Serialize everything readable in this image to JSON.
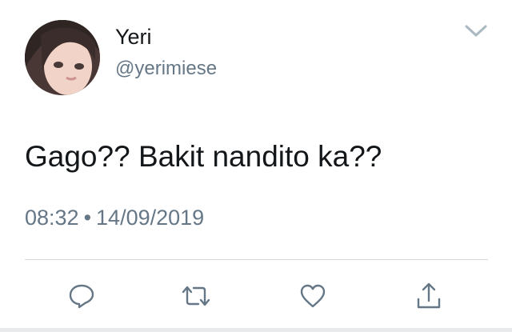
{
  "user": {
    "display_name": "Yeri",
    "handle": "@yerimiese"
  },
  "tweet": {
    "text": "Gago?? Bakit nandito ka??",
    "time": "08:32",
    "separator": "•",
    "date": "14/09/2019"
  },
  "icons": {
    "menu": "chevron-down-icon",
    "reply": "reply-icon",
    "retweet": "retweet-icon",
    "like": "heart-icon",
    "share": "share-icon"
  },
  "colors": {
    "text": "#14171a",
    "secondary": "#657786",
    "icon": "#657786",
    "divider": "#d5d9dc"
  }
}
